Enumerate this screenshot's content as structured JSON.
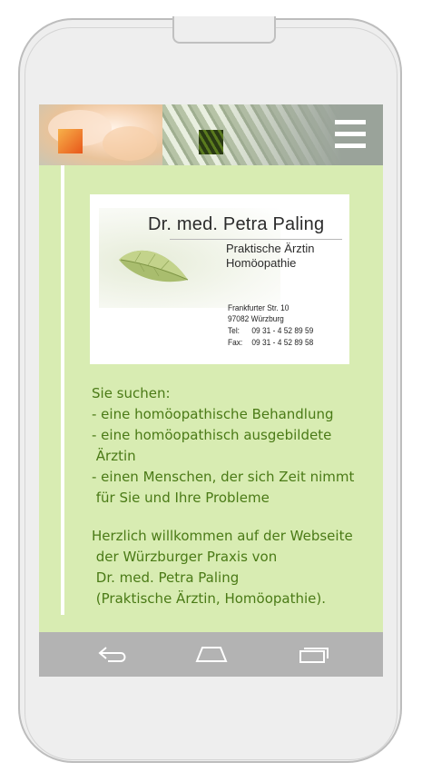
{
  "header": {
    "menu_icon": "hamburger-menu-icon"
  },
  "card": {
    "name": "Dr. med. Petra Paling",
    "subtitle_line1": "Praktische Ärztin",
    "subtitle_line2": "Homöopathie",
    "street": "Frankfurter Str. 10",
    "city": "97082 Würzburg",
    "tel_label": "Tel:",
    "tel": "09 31 - 4 52 89 59",
    "fax_label": "Fax:",
    "fax": "09 31 - 4 52 89 58"
  },
  "content": {
    "intro": "Sie suchen:\n- eine homöopathische Behandlung\n- eine homöopathisch ausgebildete\n Ärztin\n- einen Menschen, der sich Zeit nimmt\n für Sie und Ihre Probleme",
    "welcome": "Herzlich willkommen auf der Webseite\n der Würzburger Praxis von\n Dr. med. Petra Paling\n (Praktische Ärztin, Homöopathie)."
  },
  "navbar": {
    "back_icon": "back-arrow-icon",
    "home_icon": "home-icon",
    "recents_icon": "recent-apps-icon"
  },
  "colors": {
    "screen_bg": "#d8ecb2",
    "text": "#4a7a16",
    "navbar": "#b3b3b3"
  }
}
